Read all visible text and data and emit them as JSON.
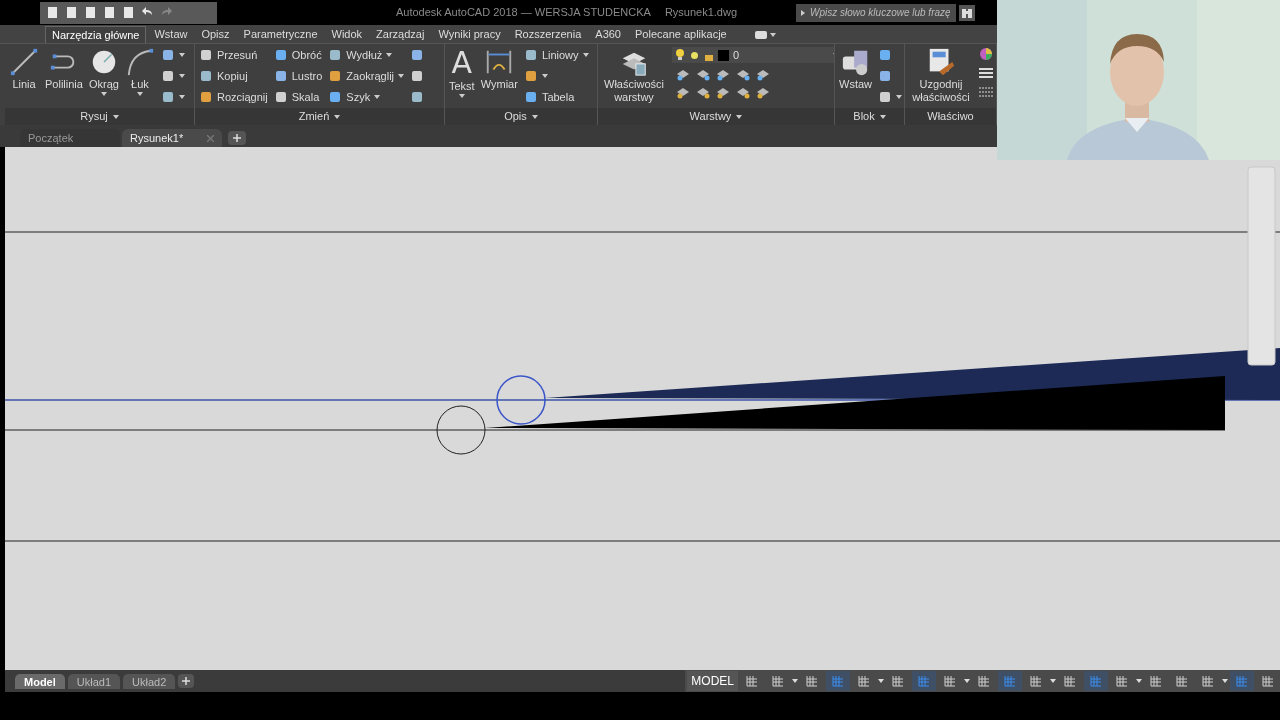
{
  "title_bar": {
    "product": "Autodesk AutoCAD 2018 — WERSJA STUDENCKA",
    "file": "Rysunek1.dwg",
    "search": {
      "placeholder": "Wpisz słowo kluczowe lub frazę"
    }
  },
  "ribbon_tabs": [
    {
      "label": "Narzędzia główne",
      "selected": true
    },
    {
      "label": "Wstaw",
      "selected": false
    },
    {
      "label": "Opisz",
      "selected": false
    },
    {
      "label": "Parametryczne",
      "selected": false
    },
    {
      "label": "Widok",
      "selected": false
    },
    {
      "label": "Zarządzaj",
      "selected": false
    },
    {
      "label": "Wyniki pracy",
      "selected": false
    },
    {
      "label": "Rozszerzenia",
      "selected": false
    },
    {
      "label": "A360",
      "selected": false
    },
    {
      "label": "Polecane aplikacje",
      "selected": false
    }
  ],
  "panels": [
    {
      "title": "Rysuj",
      "groups": [
        {
          "kind": "large",
          "label": "Linia",
          "dropdown": false
        },
        {
          "kind": "large",
          "label": "Polilinia",
          "dropdown": false
        },
        {
          "kind": "large",
          "label": "Okrąg",
          "dropdown": true
        },
        {
          "kind": "large",
          "label": "Łuk",
          "dropdown": true
        },
        {
          "kind": "icons",
          "items": [
            {
              "dropdown": true
            },
            {
              "dropdown": true
            },
            {
              "dropdown": true
            }
          ]
        }
      ]
    },
    {
      "title": "Zmień",
      "groups": [
        {
          "kind": "small",
          "items": [
            {
              "label": "Przesuń",
              "dropdown": false
            },
            {
              "label": "Kopiuj",
              "dropdown": false
            },
            {
              "label": "Rozciągnij",
              "dropdown": false
            }
          ]
        },
        {
          "kind": "small",
          "items": [
            {
              "label": "Obróć",
              "dropdown": false
            },
            {
              "label": "Lustro",
              "dropdown": false
            },
            {
              "label": "Skala",
              "dropdown": false
            }
          ]
        },
        {
          "kind": "small",
          "items": [
            {
              "label": "Wydłuż",
              "dropdown": true
            },
            {
              "label": "Zaokrąglij",
              "dropdown": true
            },
            {
              "label": "Szyk",
              "dropdown": true
            }
          ]
        },
        {
          "kind": "icons",
          "items": [
            {
              "dropdown": false
            },
            {
              "dropdown": false
            },
            {
              "dropdown": false
            }
          ]
        }
      ]
    },
    {
      "title": "Opis",
      "groups": [
        {
          "kind": "large",
          "label": "Tekst",
          "glyph": "A",
          "dropdown": true
        },
        {
          "kind": "large",
          "label": "Wymiar",
          "dropdown": false
        },
        {
          "kind": "small",
          "items": [
            {
              "label": "Liniowy",
              "dropdown": true
            },
            {
              "dropdown": true
            },
            {
              "label": "Tabela",
              "dropdown": false
            }
          ]
        }
      ]
    },
    {
      "title": "Warstwy",
      "groups": [
        {
          "kind": "large",
          "label": "Właściwości warstwy",
          "dropdown": false
        },
        {
          "kind": "layers",
          "layer": "0"
        }
      ]
    },
    {
      "title": "Blok",
      "groups": [
        {
          "kind": "large",
          "label": "Wstaw",
          "dropdown": false
        },
        {
          "kind": "icons",
          "items": [
            {
              "dropdown": false
            },
            {
              "dropdown": false
            },
            {
              "dropdown": true
            }
          ]
        }
      ]
    },
    {
      "title": "Właściwo",
      "groups": [
        {
          "kind": "large",
          "label": "Uzgodnij właściwości",
          "dropdown": false
        },
        {
          "kind": "props"
        }
      ]
    }
  ],
  "doc_tabs": [
    {
      "label": "Początek",
      "selected": false
    },
    {
      "label": "Rysunek1*",
      "selected": true
    }
  ],
  "layout_tabs": [
    {
      "label": "Model",
      "selected": true
    },
    {
      "label": "Układ1",
      "selected": false
    },
    {
      "label": "Układ2",
      "selected": false
    }
  ],
  "status_bar": {
    "space": "MODEL",
    "toggles": [
      {
        "on": false
      },
      {
        "on": false
      },
      {
        "on": false
      },
      {
        "on": true
      },
      {
        "on": false
      },
      {
        "on": false
      },
      {
        "on": true
      },
      {
        "on": false
      },
      {
        "on": false
      },
      {
        "on": true
      },
      {
        "on": false
      },
      {
        "on": false
      },
      {
        "on": true
      },
      {
        "on": false
      },
      {
        "on": false
      },
      {
        "on": false
      },
      {
        "on": false
      },
      {
        "on": true
      },
      {
        "on": false
      }
    ]
  }
}
